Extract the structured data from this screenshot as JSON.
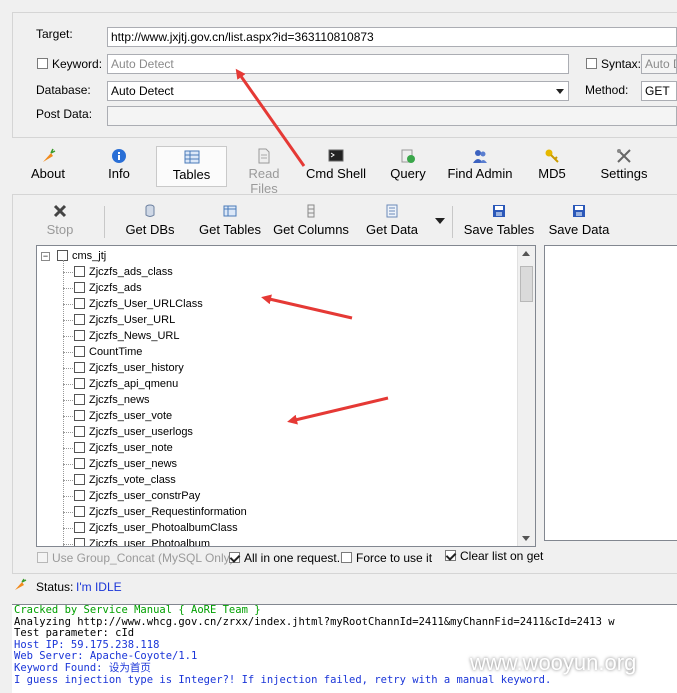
{
  "form": {
    "target_label": "Target:",
    "target_value": "http://www.jxjtj.gov.cn/list.aspx?id=363110810873",
    "keyword_label": "Keyword:",
    "keyword_placeholder": "Auto Detect",
    "syntax_label": "Syntax:",
    "syntax_value": "Auto D",
    "database_label": "Database:",
    "database_value": "Auto Detect",
    "method_label": "Method:",
    "method_value": "GET",
    "postdata_label": "Post Data:"
  },
  "toolbar": {
    "about": "About",
    "info": "Info",
    "tables": "Tables",
    "read_files": "Read Files",
    "cmd_shell": "Cmd Shell",
    "query": "Query",
    "find_admin": "Find Admin",
    "md5": "MD5",
    "settings": "Settings"
  },
  "subtoolbar": {
    "stop": "Stop",
    "get_dbs": "Get DBs",
    "get_tables": "Get Tables",
    "get_columns": "Get Columns",
    "get_data": "Get Data",
    "save_tables": "Save Tables",
    "save_data": "Save Data"
  },
  "tree": {
    "db": "cms_jtj",
    "tables": [
      "Zjczfs_ads_class",
      "Zjczfs_ads",
      "Zjczfs_User_URLClass",
      "Zjczfs_User_URL",
      "Zjczfs_News_URL",
      "CountTime",
      "Zjczfs_user_history",
      "Zjczfs_api_qmenu",
      "Zjczfs_news",
      "Zjczfs_user_vote",
      "Zjczfs_user_userlogs",
      "Zjczfs_user_note",
      "Zjczfs_user_news",
      "Zjczfs_vote_class",
      "Zjczfs_user_constrPay",
      "Zjczfs_user_Requestinformation",
      "Zjczfs_user_PhotoalbumClass",
      "Zjczfs_user_Photoalbum"
    ]
  },
  "options": {
    "group_concat": "Use Group_Concat (MySQL Only)",
    "all_in_one": "All in one request.",
    "force": "Force to use it",
    "clear_list": "Clear list on get"
  },
  "status": {
    "label": "Status:",
    "value": "I'm IDLE"
  },
  "log": [
    {
      "text": "Cracked by Service Manual { AoRE Team }",
      "color": "green"
    },
    {
      "text": "Analyzing http://www.whcg.gov.cn/zrxx/index.jhtml?myRootChannId=2411&myChannFid=2411&cId=2413 w",
      "color": "black"
    },
    {
      "text": "Test parameter: cId",
      "color": "black"
    },
    {
      "text": "Host IP: 59.175.238.118",
      "color": "blue"
    },
    {
      "text": "Web Server: Apache-Coyote/1.1",
      "color": "blue"
    },
    {
      "text": "Keyword Found: 设为首页",
      "color": "blue"
    },
    {
      "text": "I guess injection type is Integer?! If injection failed, retry with a manual keyword.",
      "color": "blue"
    }
  ],
  "watermark": "www.wooyun.org",
  "colors": {
    "arrow": "#e53935",
    "log_green": "#00a000",
    "log_blue": "#1a35d8"
  }
}
